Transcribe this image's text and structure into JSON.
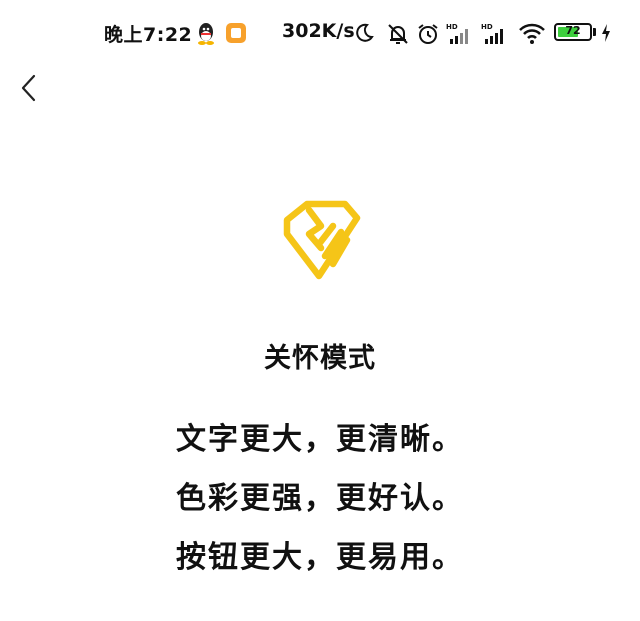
{
  "status_bar": {
    "time": "晚上7:22",
    "network_speed": "302K/s",
    "battery_level": "72",
    "battery_fraction": 0.72,
    "icons": [
      "qq-icon",
      "app-notification-icon",
      "moon-icon",
      "bell-muted-icon",
      "alarm-icon",
      "signal-hd-icon",
      "signal-hd-icon",
      "wifi-icon",
      "battery-icon",
      "charging-icon"
    ],
    "signal_label_1": "HD",
    "signal_label_2": "HD"
  },
  "nav": {
    "back_icon": "chevron-left-icon"
  },
  "hero": {
    "icon": "care-heart-hand-icon",
    "accent_color": "#F5C518"
  },
  "content": {
    "title": "关怀模式",
    "features": [
      "文字更大，更清晰。",
      "色彩更强，更好认。",
      "按钮更大，更易用。"
    ]
  }
}
